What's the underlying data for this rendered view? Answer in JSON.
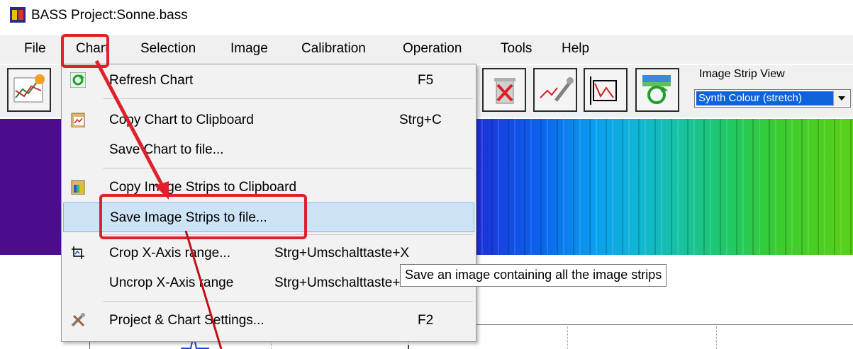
{
  "window": {
    "title": "BASS Project:Sonne.bass"
  },
  "menubar": {
    "items": [
      "File",
      "Chart",
      "Selection",
      "Image",
      "Calibration",
      "Operation",
      "Tools",
      "Help"
    ]
  },
  "toolbar": {
    "image_strip_view_label": "Image Strip View",
    "image_strip_view_value": "Synth Colour (stretch)"
  },
  "chart_menu": {
    "items": [
      {
        "label": "Refresh Chart",
        "shortcut": "F5",
        "icon": "refresh-icon"
      },
      {
        "label": "Copy Chart to Clipboard",
        "shortcut": "Strg+C",
        "icon": "clipboard-chart-icon"
      },
      {
        "label": "Save Chart to file...",
        "shortcut": ""
      },
      {
        "label": "Copy Image Strips to Clipboard",
        "shortcut": "",
        "icon": "clipboard-strips-icon"
      },
      {
        "label": "Save Image Strips to file...",
        "shortcut": ""
      },
      {
        "label": "Crop X-Axis range...",
        "shortcut": "Strg+Umschalttaste+X",
        "icon": "crop-icon"
      },
      {
        "label": "Uncrop X-Axis range",
        "shortcut": "Strg+Umschalttaste+",
        "icon": ""
      },
      {
        "label": "Project & Chart Settings...",
        "shortcut": "F2",
        "icon": "tools-icon"
      }
    ]
  },
  "tooltip": {
    "text": "Save an image containing all the image strips"
  },
  "colors": {
    "highlight_red": "#e0202a",
    "menu_hover": "#cde4f7",
    "selection_blue": "#0f63d8",
    "strip_purple": "#4b0d8c"
  }
}
